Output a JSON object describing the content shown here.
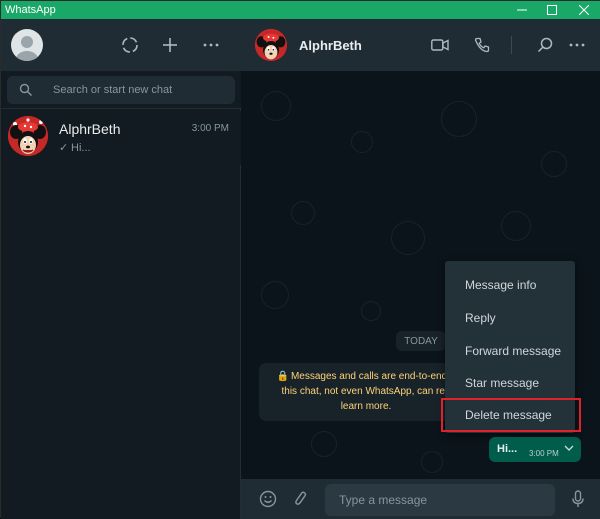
{
  "window": {
    "title": "WhatsApp",
    "accent": "#1aa869"
  },
  "left": {
    "search": {
      "placeholder": "Search or start new chat"
    },
    "chats": [
      {
        "name": "AlphrBeth",
        "time": "3:00 PM",
        "check": "✓",
        "preview": "Hi..."
      }
    ]
  },
  "right": {
    "contact_name": "AlphrBeth",
    "date_chip": "TODAY",
    "e2e_notice": "Messages and calls are end-to-end e this chat, not even WhatsApp, can rea learn more.",
    "message": {
      "text": "Hi...",
      "time": "3:00 PM"
    },
    "context_menu": {
      "items": [
        {
          "label": "Message info"
        },
        {
          "label": "Reply"
        },
        {
          "label": "Forward message"
        },
        {
          "label": "Star message"
        },
        {
          "label": "Delete message",
          "highlighted": true
        }
      ]
    },
    "composer": {
      "placeholder": "Type a message"
    }
  },
  "colors": {
    "outgoing_bubble": "#005c4b",
    "highlight_box": "#e0202a",
    "notice_text": "#ffd279"
  }
}
